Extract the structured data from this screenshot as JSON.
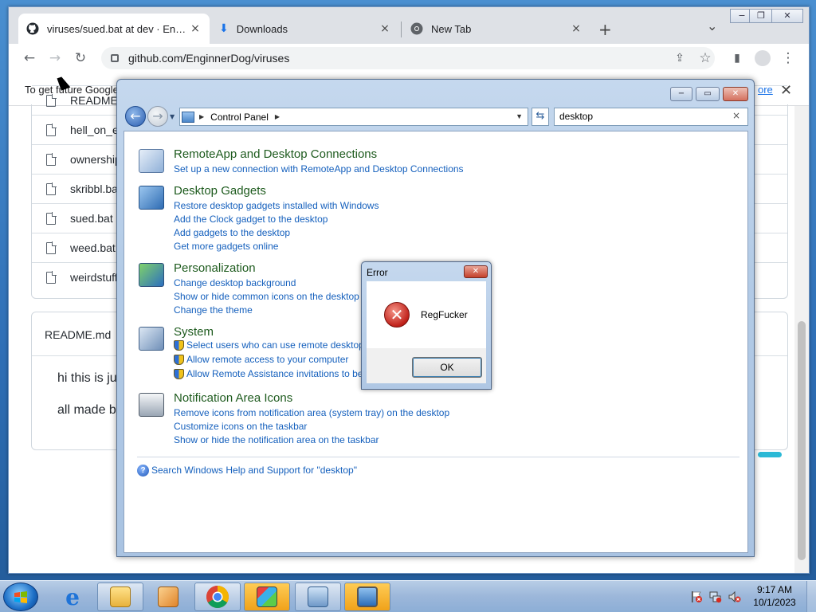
{
  "chrome": {
    "tabs": [
      {
        "title": "viruses/sued.bat at dev · EnginnerDog/viruses",
        "icon": "github-icon",
        "active": true
      },
      {
        "title": "Downloads",
        "icon": "download-icon",
        "active": false
      },
      {
        "title": "New Tab",
        "icon": "chrome-icon",
        "active": false
      }
    ],
    "tab_close": "×",
    "new_tab": "+",
    "tab_search": "⌄",
    "window_buttons": {
      "minimize": "−",
      "restore": "❐",
      "close": "✕"
    },
    "url": "github.com/EnginnerDog/viruses",
    "infobar_text": "To get future Google",
    "infobar_link": "ore",
    "infobar_close": "✕"
  },
  "github": {
    "files": [
      {
        "name": "README.md"
      },
      {
        "name": "hell_on_ea"
      },
      {
        "name": "ownership"
      },
      {
        "name": "skribbl.ba"
      },
      {
        "name": "sued.bat"
      },
      {
        "name": "weed.bat"
      },
      {
        "name": "weirdstuff"
      }
    ],
    "readme_title": "README.md",
    "readme_lines": [
      "hi this is ju",
      "all made by"
    ]
  },
  "control_panel": {
    "window_buttons": {
      "minimize": "−",
      "maximize": "▭",
      "close": "✕"
    },
    "breadcrumb": "Control Panel",
    "search_value": "desktop",
    "search_clear": "×",
    "sections": [
      {
        "title": "RemoteApp and Desktop Connections",
        "icon": "remoteapp-icon",
        "links": [
          {
            "text": "Set up a new connection with RemoteApp and Desktop Connections",
            "shield": false
          }
        ]
      },
      {
        "title": "Desktop Gadgets",
        "icon": "gadgets-icon",
        "links": [
          {
            "text": "Restore desktop gadgets installed with Windows",
            "shield": false
          },
          {
            "text": "Add the Clock gadget to the desktop",
            "shield": false
          },
          {
            "text": "Add gadgets to the desktop",
            "shield": false
          },
          {
            "text": "Get more gadgets online",
            "shield": false
          }
        ]
      },
      {
        "title": "Personalization",
        "icon": "personalization-icon",
        "links": [
          {
            "text": "Change desktop background",
            "shield": false
          },
          {
            "text": "Show or hide common icons on the desktop",
            "shield": false
          },
          {
            "text": "Change the theme",
            "shield": false
          }
        ]
      },
      {
        "title": "System",
        "icon": "system-icon",
        "links": [
          {
            "text": "Select users who can use remote desktop",
            "shield": true
          },
          {
            "text": "Allow remote access to your computer",
            "shield": true
          },
          {
            "text": "Allow Remote Assistance invitations to be",
            "shield": true
          }
        ]
      },
      {
        "title": "Notification Area Icons",
        "icon": "notification-area-icon",
        "links": [
          {
            "text": "Remove icons from notification area (system tray) on the desktop",
            "shield": false
          },
          {
            "text": "Customize icons on the taskbar",
            "shield": false
          },
          {
            "text": "Show or hide the notification area on the taskbar",
            "shield": false
          }
        ]
      }
    ],
    "help_link": "Search Windows Help and Support for \"desktop\""
  },
  "error_dialog": {
    "title": "Error",
    "close": "✕",
    "icon_glyph": "✕",
    "message": "RegFucker",
    "ok_label": "OK"
  },
  "taskbar": {
    "apps": [
      {
        "name": "internet-explorer-icon",
        "open": false
      },
      {
        "name": "file-explorer-icon",
        "open": true
      },
      {
        "name": "media-player-icon",
        "open": false
      },
      {
        "name": "chrome-icon",
        "open": true
      },
      {
        "name": "paint-icon",
        "open": true
      },
      {
        "name": "control-panel-icon",
        "open": true
      },
      {
        "name": "monitor-icon",
        "open": true
      }
    ],
    "time": "9:17 AM",
    "date": "10/1/2023"
  }
}
